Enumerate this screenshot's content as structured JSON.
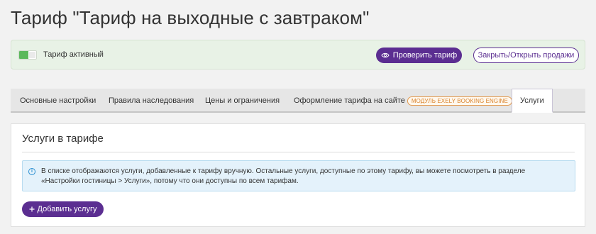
{
  "page": {
    "title": "Тариф \"Тариф на выходные с завтраком\""
  },
  "status": {
    "toggle_state": "on",
    "label": "Тариф активный",
    "check_button": "Проверить тариф",
    "check_icon": "eye-icon",
    "sales_button": "Закрыть/Открыть продажи"
  },
  "tabs": [
    {
      "label": "Основные настройки",
      "active": false
    },
    {
      "label": "Правила наследования",
      "active": false
    },
    {
      "label": "Цены и ограничения",
      "active": false
    },
    {
      "label": "Оформление тарифа на сайте",
      "badge": "МОДУЛЬ EXELY BOOKING ENGINE",
      "active": false
    },
    {
      "label": "Услуги",
      "active": true
    }
  ],
  "services": {
    "title": "Услуги в тарифе",
    "info_icon": "info-icon",
    "info_line1": "В списке отображаются услуги, добавленные к тарифу вручную. Остальные услуги, доступные по этому тарифу, вы можете посмотреть в разделе",
    "info_line2": "«Настройки гостиницы > Услуги», потому что они доступны по всем тарифам.",
    "add_icon": "plus-icon",
    "add_button": "Добавить услугу"
  },
  "colors": {
    "accent": "#5b2e91",
    "active_bar": "#e8f2e6",
    "toggle_on": "#5cb85c",
    "info_bg": "#e4f2fb",
    "badge": "#d9822b"
  }
}
